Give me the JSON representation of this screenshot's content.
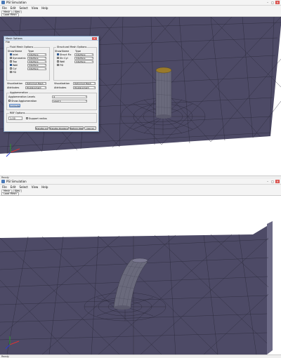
{
  "app": {
    "title": "PSI Simulation",
    "menu": [
      "File",
      "Edit",
      "Select",
      "View",
      "Help"
    ],
    "tabs": [
      "Mesh",
      "Sim"
    ],
    "toolbar_button": "Load Mesh",
    "status_text": "Ready",
    "close_glyph": "✕",
    "min_glyph": "–",
    "max_glyph": "□"
  },
  "dialog": {
    "title": "Mesh Options",
    "menu": "File",
    "fluid_group": "Fluid Mesh Options",
    "struct_group": "Structural Mesh Options",
    "col_show": "Show",
    "col_name": "Name",
    "col_type": "Type",
    "fluid_rows": [
      {
        "name": "Inlet",
        "type": "Interface",
        "checked": true
      },
      {
        "name": "Symmetric",
        "type": "Interface",
        "checked": false
      },
      {
        "name": "Top",
        "type": "Interface",
        "checked": false
      },
      {
        "name": "Wall",
        "type": "Interface",
        "checked": true
      },
      {
        "name": "Cyl",
        "type": "Interface",
        "checked": false
      },
      {
        "name": "FSI",
        "type": "",
        "checked": false
      }
    ],
    "struct_rows": [
      {
        "name": "Struct Fix",
        "type": "Interface",
        "checked": true
      },
      {
        "name": "Str Cyl",
        "type": "Interface",
        "checked": false
      },
      {
        "name": "Wall",
        "type": "Interface",
        "checked": false
      },
      {
        "name": "FSI",
        "type": "",
        "checked": false
      }
    ],
    "vis_label": "Visualization",
    "vis_value": "Deformed Mesh",
    "attr_label": "Attributes",
    "attr_value": "Displacement",
    "svis_value": "Deformed Mesh",
    "sattr_value": "Displacement",
    "agg_group": "Agglomeration",
    "agg_levels_label": "Agglomeration Levels",
    "agg_levels_value": "4",
    "show_agg_label": "Show Agglomeration",
    "level_value": "Level 1",
    "compute_button": "Compute",
    "rbf_group": "RBF Options",
    "rbf_value": "1.00",
    "support_label": "Support radius",
    "buttons": [
      "Transfer Loads",
      "Transfer Displacements",
      "Deform Mesh",
      "Cancel"
    ]
  },
  "axes": {
    "x": "x",
    "y": "y",
    "z": "z"
  },
  "colors": {
    "mesh_bg": "#4d4a66",
    "mesh_line": "#2a2838",
    "cylinder": "#6a6a7c",
    "cap": "#9a7a2a"
  }
}
